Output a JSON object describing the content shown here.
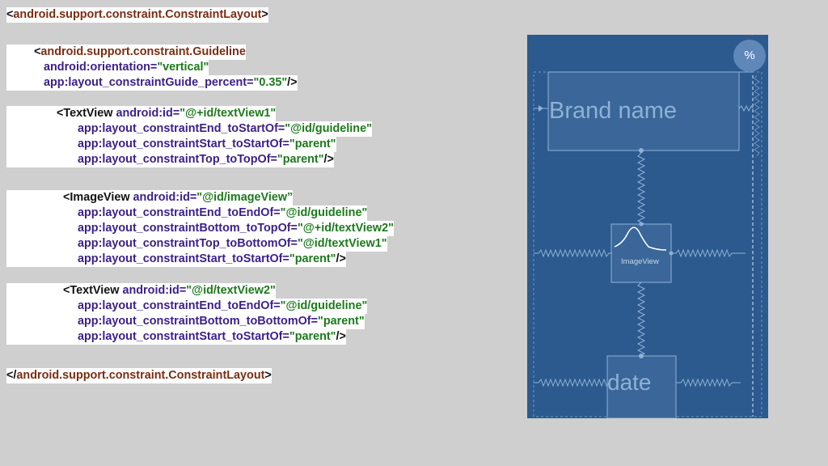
{
  "code_lines": [
    [
      {
        "t": "<",
        "c": "plain"
      },
      {
        "t": "android.support.constraint.ConstraintLayout",
        "c": "tag"
      },
      {
        "t": ">",
        "c": "plain"
      }
    ],
    [
      {
        "t": "<",
        "c": "plain"
      },
      {
        "t": "android.support.constraint.Guideline",
        "c": "tag"
      }
    ],
    [
      {
        "t": "android:orientation=",
        "c": "attr"
      },
      {
        "t": "\"vertical\"",
        "c": "val"
      }
    ],
    [
      {
        "t": "app:layout_constraintGuide_percent=",
        "c": "attr"
      },
      {
        "t": "\"0.35\"",
        "c": "val"
      },
      {
        "t": "/>",
        "c": "plain"
      }
    ],
    [
      {
        "t": "<TextView ",
        "c": "plain"
      },
      {
        "t": "android:id=",
        "c": "attr"
      },
      {
        "t": "\"@+id/textView1\"",
        "c": "val"
      }
    ],
    [
      {
        "t": "app:layout_constraintEnd_toStartOf=",
        "c": "attr"
      },
      {
        "t": "\"@id/guideline\"",
        "c": "val"
      }
    ],
    [
      {
        "t": "app:layout_constraintStart_toStartOf=",
        "c": "attr"
      },
      {
        "t": "\"parent\"",
        "c": "val"
      }
    ],
    [
      {
        "t": "app:layout_constraintTop_toTopOf=",
        "c": "attr"
      },
      {
        "t": "\"parent\"",
        "c": "val"
      },
      {
        "t": "/>",
        "c": "plain"
      }
    ],
    [
      {
        "t": "<ImageView ",
        "c": "plain"
      },
      {
        "t": "android:id=",
        "c": "attr"
      },
      {
        "t": "\"@id/imageView”",
        "c": "val"
      }
    ],
    [
      {
        "t": "app:layout_constraintEnd_toEndOf=",
        "c": "attr"
      },
      {
        "t": "\"@id/guideline\"",
        "c": "val"
      }
    ],
    [
      {
        "t": "app:layout_constraintBottom_toTopOf=",
        "c": "attr"
      },
      {
        "t": "\"@+id/textView2\"",
        "c": "val"
      }
    ],
    [
      {
        "t": "app:layout_constraintTop_toBottomOf=",
        "c": "attr"
      },
      {
        "t": "\"@id/textView1\"",
        "c": "val"
      }
    ],
    [
      {
        "t": "app:layout_constraintStart_toStartOf=",
        "c": "attr"
      },
      {
        "t": "\"parent\"",
        "c": "val"
      },
      {
        "t": "/>",
        "c": "plain"
      }
    ],
    [
      {
        "t": "<TextView ",
        "c": "plain"
      },
      {
        "t": "android:id=",
        "c": "attr"
      },
      {
        "t": "\"@id/textView2\"",
        "c": "val"
      }
    ],
    [
      {
        "t": "app:layout_constraintEnd_toEndOf=",
        "c": "attr"
      },
      {
        "t": "\"@id/guideline\"",
        "c": "val"
      }
    ],
    [
      {
        "t": "app:layout_constraintBottom_toBottomOf=",
        "c": "attr"
      },
      {
        "t": "\"parent\"",
        "c": "val"
      }
    ],
    [
      {
        "t": "app:layout_constraintStart_toStartOf=",
        "c": "attr"
      },
      {
        "t": "\"parent\"",
        "c": "val"
      },
      {
        "t": "/>",
        "c": "plain"
      }
    ],
    [
      {
        "t": "</",
        "c": "plain"
      },
      {
        "t": "android.support.constraint.ConstraintLayout",
        "c": "tag"
      },
      {
        "t": ">",
        "c": "plain"
      }
    ]
  ],
  "blueprint": {
    "brand_label": "Brand name",
    "image_label": "ImageView",
    "date_label": "date",
    "percent_badge": "%"
  },
  "colors": {
    "tag": "#7b2d12",
    "attr": "#3b1f8a",
    "value": "#1c7a1c",
    "blueprint_bg": "#2c5a8e"
  }
}
